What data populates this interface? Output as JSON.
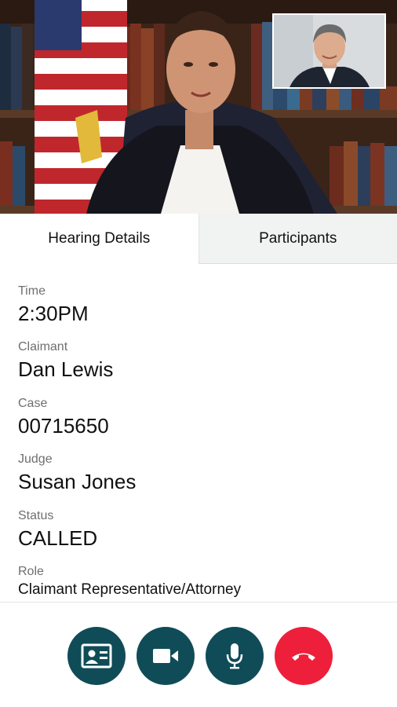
{
  "tabs": [
    {
      "label": "Hearing Details",
      "active": true
    },
    {
      "label": "Participants",
      "active": false
    }
  ],
  "details": {
    "time": {
      "label": "Time",
      "value": "2:30PM"
    },
    "claimant": {
      "label": "Claimant",
      "value": "Dan Lewis"
    },
    "case": {
      "label": "Case",
      "value": "00715650"
    },
    "judge": {
      "label": "Judge",
      "value": "Susan Jones"
    },
    "status": {
      "label": "Status",
      "value": "CALLED"
    },
    "role": {
      "label": "Role",
      "value": "Claimant Representative/Attorney"
    }
  },
  "controls": [
    {
      "icon": "contact-card-icon",
      "color": "#104c57"
    },
    {
      "icon": "video-camera-icon",
      "color": "#104c57"
    },
    {
      "icon": "microphone-icon",
      "color": "#104c57"
    },
    {
      "icon": "hang-up-icon",
      "color": "#ee1f3a"
    }
  ],
  "colors": {
    "control_teal": "#104c57",
    "end_call_red": "#ee1f3a",
    "inactive_tab_bg": "#f1f2f2",
    "label_gray": "#6f6f6f"
  }
}
